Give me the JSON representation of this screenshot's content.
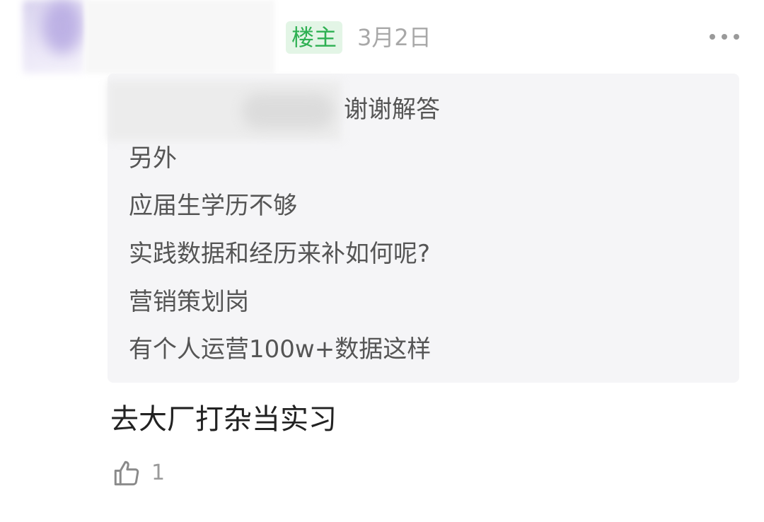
{
  "post": {
    "username": "",
    "op_badge": "楼主",
    "date": "3月2日"
  },
  "quote": {
    "first_line": "谢谢解答",
    "lines": [
      "另外",
      "应届生学历不够",
      "实践数据和经历来补如何呢?",
      "营销策划岗",
      "有个人运营100w+数据这样"
    ]
  },
  "reply": {
    "text": "去大厂打杂当实习"
  },
  "actions": {
    "like_icon": "thumbs-up-icon",
    "like_count": "1",
    "more_icon": "more-dots-icon"
  },
  "colors": {
    "op_badge_bg": "#e3f5e6",
    "op_badge_text": "#2eb052",
    "quote_bg": "#f5f5f7",
    "muted_text": "#a8a8a8"
  }
}
